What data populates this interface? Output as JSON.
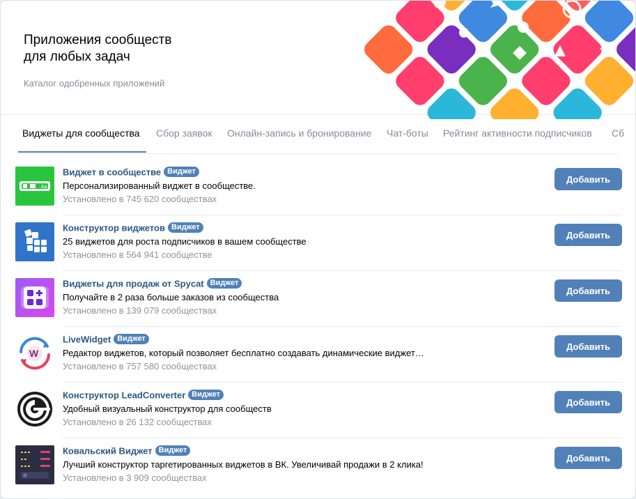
{
  "header": {
    "title_line1": "Приложения сообществ",
    "title_line2": "для любых задач",
    "subtitle": "Каталог одобренных приложений"
  },
  "tabs": [
    {
      "label": "Виджеты для сообщества",
      "active": true
    },
    {
      "label": "Сбор заявок",
      "active": false
    },
    {
      "label": "Онлайн-запись и бронирование",
      "active": false
    },
    {
      "label": "Чат-боты",
      "active": false
    },
    {
      "label": "Рейтинг активности подписчиков",
      "active": false
    },
    {
      "label": "Сб",
      "active": false
    }
  ],
  "apps": [
    {
      "title": "Виджет в сообществе",
      "badge": "Виджет",
      "description": "Персонализированный виджет в сообществе.",
      "installs": "Установлено в 745 620 сообществах",
      "button": "Добавить",
      "icon": "widget-in-community-icon"
    },
    {
      "title": "Конструктор виджетов",
      "badge": "Виджет",
      "description": "25 виджетов для роста подписчиков в вашем сообществе",
      "installs": "Установлено в 564 941 сообществе",
      "button": "Добавить",
      "icon": "widget-builder-icon"
    },
    {
      "title": "Виджеты для продаж от Spycat",
      "badge": "Виджет",
      "description": "Получайте в 2 раза больше заказов из сообщества",
      "installs": "Установлено в 139 079 сообществах",
      "button": "Добавить",
      "icon": "spycat-icon"
    },
    {
      "title": "LiveWidget",
      "badge": "Виджет",
      "description": "Редактор виджетов, который позволяет бесплатно создавать динамические виджет…",
      "installs": "Установлено в 757 580 сообществах",
      "button": "Добавить",
      "icon": "livewidget-icon"
    },
    {
      "title": "Конструктор LeadConverter",
      "badge": "Виджет",
      "description": "Удобный визуальный конструктор для сообществ",
      "installs": "Установлено в 26 132 сообществах",
      "button": "Добавить",
      "icon": "leadconverter-icon"
    },
    {
      "title": "Ковальский Виджет",
      "badge": "Виджет",
      "description": "Лучший конструктор таргетированных виджетов в ВК. Увеличивай продажи в 2 клика!",
      "installs": "Установлено в 3 909 сообществах",
      "button": "Добавить",
      "icon": "kovalsky-icon"
    }
  ]
}
